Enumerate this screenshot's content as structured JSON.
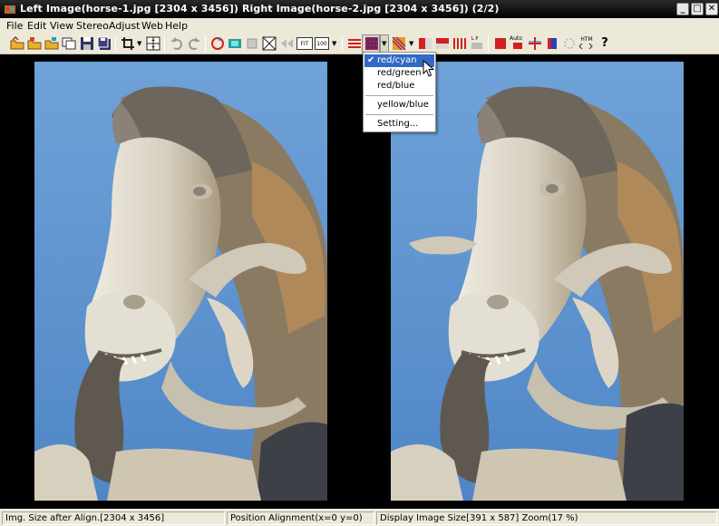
{
  "window": {
    "title": "Left Image(horse-1.jpg [2304 x 3456]) Right Image(horse-2.jpg [2304 x 3456])  (2/2)",
    "minimize": "_",
    "maximize": "□",
    "close": "✕"
  },
  "menu": [
    "File",
    "Edit",
    "View",
    "Stereo",
    "Adjust",
    "Web",
    "Help"
  ],
  "toolbar": {
    "fit_label": "FIT",
    "zoom100_label": "100",
    "auto_label": "Auto",
    "html_label": "HTM",
    "help_label": "?",
    "lp_label": "L P",
    "icons": [
      "open-icon",
      "open-left-icon",
      "open-right-icon",
      "open-multi-icon",
      "save-icon",
      "save-all-icon",
      "crop-icon",
      "grid-icon",
      "undo-icon",
      "redo-icon",
      "swap-icon",
      "side-by-side-icon",
      "stop-icon",
      "prev-icon",
      "fit-icon",
      "zoom100-icon",
      "anaglyph-icon",
      "color-anaglyph-icon",
      "dubois-icon",
      "interlace-icon",
      "above-below-icon",
      "column-icon",
      "lp-icon",
      "red-icon",
      "auto-align-icon",
      "align-icon",
      "blue-icon",
      "settings-icon",
      "html-icon",
      "help-icon"
    ]
  },
  "dropdown": {
    "items": [
      {
        "label": "red/cyan",
        "checked": true,
        "selected": true
      },
      {
        "label": "red/green",
        "checked": false,
        "selected": false
      },
      {
        "label": "red/blue",
        "checked": false,
        "selected": false
      },
      {
        "label": "yellow/blue",
        "checked": false,
        "selected": false
      },
      {
        "label": "Setting...",
        "checked": false,
        "selected": false
      }
    ],
    "check_mark": "✔"
  },
  "statusbar": {
    "size_after_align": "Img. Size after Align.[2304 x 3456]",
    "position_alignment": "Position Alignment(x=0 y=0)",
    "display_size": "Display Image Size[391 x 587]  Zoom(17 %)"
  },
  "colors": {
    "sky": "#5f94cf",
    "stone": "#d8d2c4",
    "title_bg": "#000000",
    "menu_highlight": "#316ac5"
  }
}
